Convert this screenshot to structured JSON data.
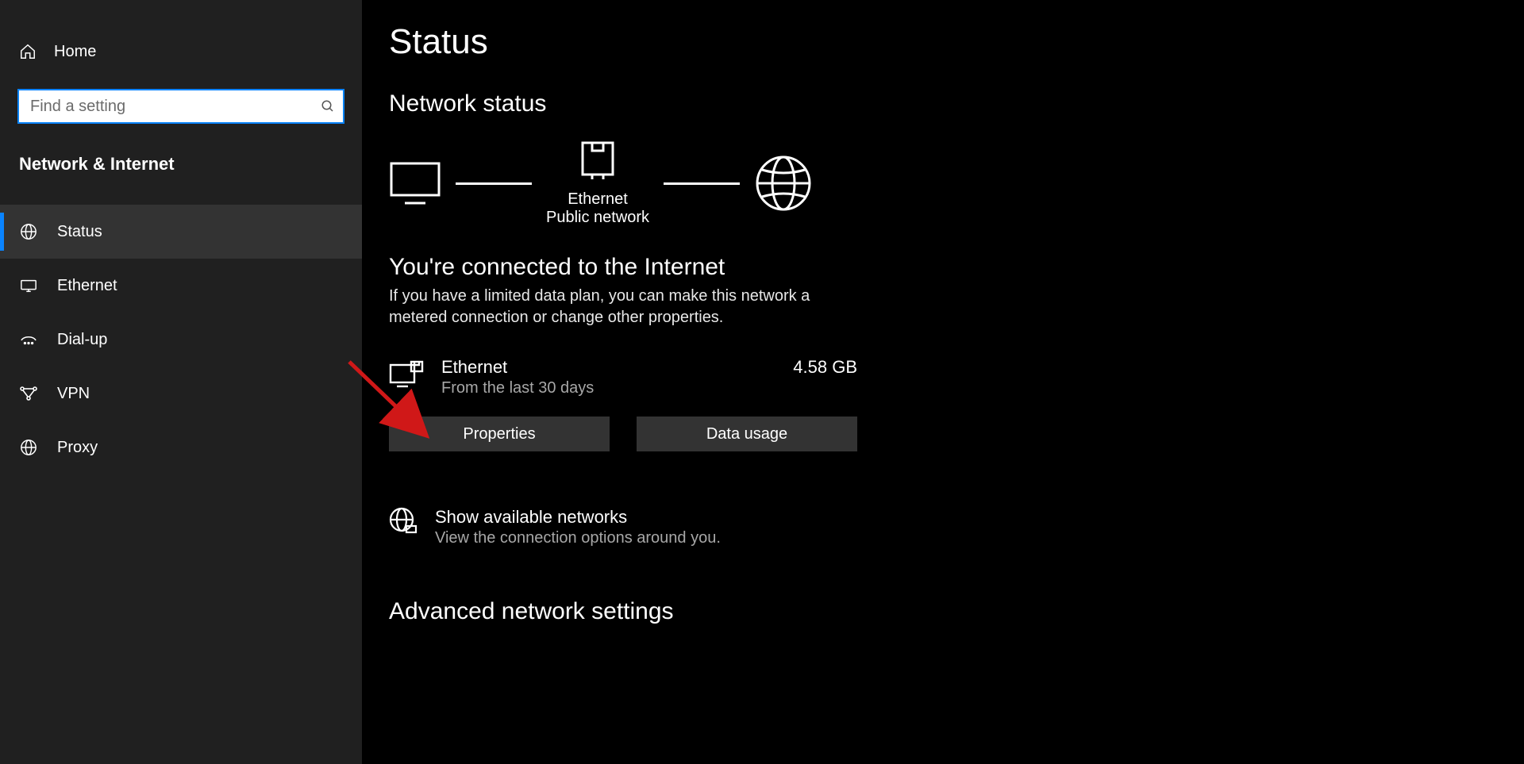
{
  "sidebar": {
    "home_label": "Home",
    "search_placeholder": "Find a setting",
    "category_label": "Network & Internet",
    "items": [
      {
        "label": "Status",
        "icon": "globe-icon",
        "active": true
      },
      {
        "label": "Ethernet",
        "icon": "ethernet-icon",
        "active": false
      },
      {
        "label": "Dial-up",
        "icon": "dialup-icon",
        "active": false
      },
      {
        "label": "VPN",
        "icon": "vpn-icon",
        "active": false
      },
      {
        "label": "Proxy",
        "icon": "proxy-icon",
        "active": false
      }
    ]
  },
  "main": {
    "title": "Status",
    "network_status_heading": "Network status",
    "diagram": {
      "connection_name": "Ethernet",
      "connection_type": "Public network"
    },
    "connected_heading": "You're connected to the Internet",
    "connected_body": "If you have a limited data plan, you can make this network a metered connection or change other properties.",
    "connection": {
      "name": "Ethernet",
      "sub": "From the last 30 days",
      "usage": "4.58 GB"
    },
    "properties_button": "Properties",
    "data_usage_button": "Data usage",
    "show_networks": {
      "title": "Show available networks",
      "sub": "View the connection options around you."
    },
    "advanced_heading": "Advanced network settings"
  }
}
